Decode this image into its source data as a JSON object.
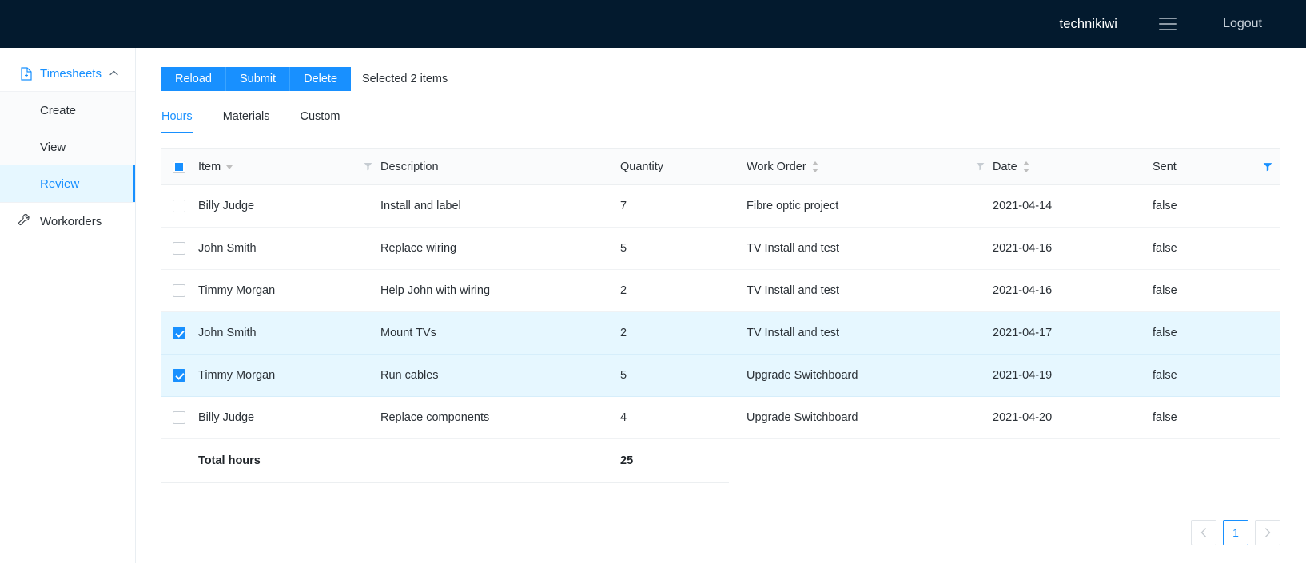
{
  "topbar": {
    "username": "technikiwi",
    "menu_icon": "hamburger-icon",
    "logout_label": "Logout"
  },
  "sidebar": {
    "group": {
      "label": "Timesheets",
      "icon": "document-icon",
      "caret": "chevron-up-icon",
      "expanded": true,
      "items": [
        {
          "label": "Create",
          "active": false
        },
        {
          "label": "View",
          "active": false
        },
        {
          "label": "Review",
          "active": true
        }
      ]
    },
    "items": [
      {
        "label": "Workorders",
        "icon": "wrench-icon",
        "active": false
      }
    ]
  },
  "toolbar": {
    "reload_label": "Reload",
    "submit_label": "Submit",
    "delete_label": "Delete",
    "selection_status": "Selected 2 items"
  },
  "tabs": [
    {
      "label": "Hours",
      "active": true
    },
    {
      "label": "Materials",
      "active": false
    },
    {
      "label": "Custom",
      "active": false
    }
  ],
  "table": {
    "select_all_state": "indeterminate",
    "columns": [
      {
        "key": "item",
        "label": "Item",
        "sort": "down",
        "filter": "inactive"
      },
      {
        "key": "description",
        "label": "Description",
        "sort": "none",
        "filter": "none"
      },
      {
        "key": "quantity",
        "label": "Quantity",
        "sort": "none",
        "filter": "none"
      },
      {
        "key": "work_order",
        "label": "Work Order",
        "sort": "both",
        "filter": "inactive"
      },
      {
        "key": "date",
        "label": "Date",
        "sort": "both",
        "filter": "none"
      },
      {
        "key": "sent",
        "label": "Sent",
        "sort": "none",
        "filter": "active"
      }
    ],
    "rows": [
      {
        "selected": false,
        "item": "Billy Judge",
        "description": "Install and label",
        "quantity": "7",
        "work_order": "Fibre optic project",
        "date": "2021-04-14",
        "sent": "false"
      },
      {
        "selected": false,
        "item": "John Smith",
        "description": "Replace wiring",
        "quantity": "5",
        "work_order": "TV Install and test",
        "date": "2021-04-16",
        "sent": "false"
      },
      {
        "selected": false,
        "item": "Timmy Morgan",
        "description": "Help John with wiring",
        "quantity": "2",
        "work_order": "TV Install and test",
        "date": "2021-04-16",
        "sent": "false"
      },
      {
        "selected": true,
        "item": "John Smith",
        "description": "Mount TVs",
        "quantity": "2",
        "work_order": "TV Install and test",
        "date": "2021-04-17",
        "sent": "false"
      },
      {
        "selected": true,
        "item": "Timmy Morgan",
        "description": "Run cables",
        "quantity": "5",
        "work_order": "Upgrade Switchboard",
        "date": "2021-04-19",
        "sent": "false"
      },
      {
        "selected": false,
        "item": "Billy Judge",
        "description": "Replace components",
        "quantity": "4",
        "work_order": "Upgrade Switchboard",
        "date": "2021-04-20",
        "sent": "false"
      }
    ],
    "summary": {
      "label": "Total hours",
      "total": "25"
    }
  },
  "pagination": {
    "prev_icon": "chevron-left-icon",
    "next_icon": "chevron-right-icon",
    "current_page": "1"
  },
  "colors": {
    "accent": "#1890ff",
    "topbar_bg": "#031a2e",
    "selected_row": "#e6f7ff"
  }
}
